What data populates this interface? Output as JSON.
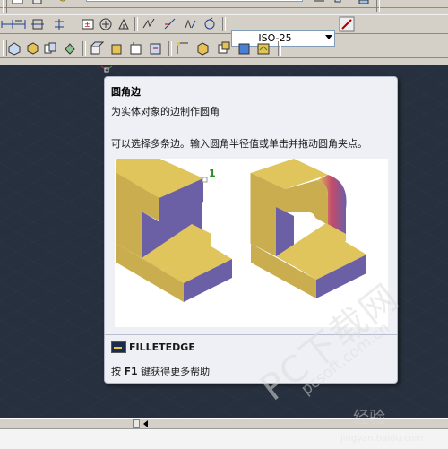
{
  "toolbar": {
    "layer_value": "0",
    "dimstyle_value": "ISO-25"
  },
  "tooltip": {
    "title": "圆角边",
    "description": "为实体对象的边制作圆角",
    "detail": "可以选择多条边。输入圆角半径值或单击并拖动圆角夹点。",
    "image_label": "1",
    "command_name": "FILLETEDGE",
    "help_prefix": "按 ",
    "help_key": "F1",
    "help_suffix": " 键获得更多帮助"
  },
  "watermark": {
    "main": "PC下载网",
    "sub": "pcsoft.com.cn",
    "baidu": "经验",
    "baidu_url": "jingyan.baidu.com"
  },
  "colors": {
    "canvas": "#27303e",
    "toolbar": "#d4d0c8",
    "tooltip_bg": "#eef0f6",
    "solid_top": "#e0c45c",
    "solid_side": "#6b5fa6",
    "solid_front": "#c9ad4e"
  }
}
